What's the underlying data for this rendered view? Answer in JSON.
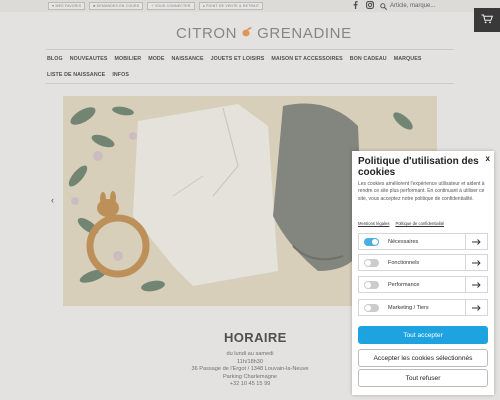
{
  "topbar": {
    "badges": [
      "♥ MES FAVORIS",
      "■ DEMANDES EN COURS",
      "+ VOUS CONNECTER",
      "● POINT DE VENTE & RETRAIT"
    ],
    "search_placeholder": "Article, marque..."
  },
  "logo": {
    "left": "CITRON",
    "right": "GRENADINE"
  },
  "nav": {
    "row1": [
      "BLOG",
      "NOUVEAUTES",
      "MOBILIER",
      "MODE",
      "NAISSANCE",
      "JOUETS ET LOISIRS",
      "MAISON ET ACCESSOIRES",
      "BON CADEAU",
      "MARQUES"
    ],
    "row2": [
      "LISTE DE NAISSANCE",
      "INFOS"
    ]
  },
  "schedule": {
    "title": "HORAIRE",
    "lines": [
      "du lundi au samedi",
      "11h/18h30",
      "36 Passage de l'Ergot / 1348 Louvain-la-Neuve",
      "Parking Charlemagne",
      "+32 10 45 15 99"
    ]
  },
  "cookie": {
    "close": "x",
    "title": "Politique d'utilisation des cookies",
    "description": "Les cookies améliorent l'expérience utilisateur et aident à rendre ce site plus performant. En continuant à utiliser ce site, vous acceptez notre politique de confidentialité.",
    "links": [
      "Mentions légales",
      "Politique de confidentialité"
    ],
    "options": [
      {
        "label": "Nécessaires",
        "on": true
      },
      {
        "label": "Fonctionnels",
        "on": false
      },
      {
        "label": "Performance",
        "on": false
      },
      {
        "label": "Marketing / Tiers",
        "on": false
      }
    ],
    "accept_all": "Tout accepter",
    "accept_selected": "Accepter les cookies sélectionnés",
    "refuse_all": "Tout refuser"
  },
  "colors": {
    "accent": "#1fa3e0",
    "cart_bg": "#3d3d3d"
  }
}
